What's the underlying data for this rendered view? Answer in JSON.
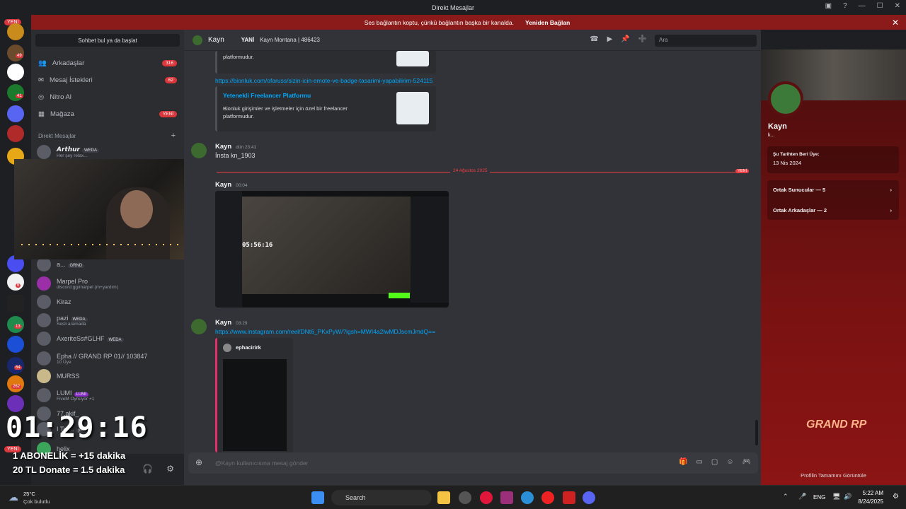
{
  "titlebar": {
    "title": "Direkt Mesajlar"
  },
  "banner": {
    "message": "Ses bağlantın koptu, çünkü bağlantın başka bir kanalda.",
    "action": "Yeniden Bağlan"
  },
  "guilds": {
    "new_badge": "YENİ",
    "new_badge_bottom": "YENİ",
    "counts": [
      "49",
      "41",
      "13",
      "64",
      "262",
      "6"
    ]
  },
  "dmlist": {
    "search": "Sohbet bul ya da başlat",
    "nav": [
      {
        "label": "Arkadaşlar",
        "count": "316"
      },
      {
        "label": "Mesaj İstekleri",
        "count": "62"
      },
      {
        "label": "Nitro Al",
        "count": ""
      },
      {
        "label": "Mağaza",
        "count": "YENİ"
      }
    ],
    "header": "Direkt Mesajlar",
    "users": [
      {
        "name": "𝘼𝙧𝙩𝙝𝙪𝙧",
        "tag": "WEDA",
        "sub": "Her şey relax..."
      },
      {
        "name": "a...",
        "tag": "GRND",
        "sub": ""
      },
      {
        "name": "Marpel Pro",
        "tag": "",
        "sub": "discord.gg/marpel (m+yardım)"
      },
      {
        "name": "Kiraz",
        "tag": "",
        "sub": ""
      },
      {
        "name": "pazi",
        "tag": "WEDA",
        "sub": "Sesli aramada"
      },
      {
        "name": "AxeriteSs#GLHF",
        "tag": "WEDA",
        "sub": ""
      },
      {
        "name": "Epha // GRAND RP 01// 103847",
        "tag": "",
        "sub": "10 Üye"
      },
      {
        "name": "MURSS",
        "tag": "",
        "sub": ""
      },
      {
        "name": "LUMI",
        "tag": "LUMI",
        "sub": "FiveM Oynuyor +1"
      },
      {
        "name": "77.akif_",
        "tag": "",
        "sub": ""
      },
      {
        "name": "I Ter...",
        "tag": "yukt",
        "sub": ""
      },
      {
        "name": "helix",
        "tag": "",
        "sub": ""
      }
    ]
  },
  "overlay": {
    "timer": "01:29:16",
    "line1": "1 ABONELİK = +15 dakika",
    "line2": "20 TL Donate = 1.5 dakika"
  },
  "chat": {
    "header_user": "Kayn",
    "header_new": "YANİ",
    "header_sub": "Kayn Montana | 486423",
    "search_placeholder": "Ara",
    "embed_top_text": "platformudur.",
    "link1": "https://bionluk.com/ofaruss/sizin-icin-emote-ve-badge-tasarimi-yapabilirim-524115",
    "embed_title": "Yetenekli Freelancer Platformu",
    "embed_desc": "Bionluk girişimler ve işletmeler için özel bir freelancer platformudur.",
    "msg1": {
      "author": "Kayn",
      "time": "dün 23:41",
      "text": "İnsta kn_1903"
    },
    "divider_date": "24 Ağustos 2025",
    "divider_new": "YENİ",
    "msg2": {
      "author": "Kayn",
      "time": "00:04"
    },
    "screenshot_timer": "05:56:16",
    "msg3": {
      "author": "Kayn",
      "time": "03:29",
      "link": "https://www.instagram.com/reel/DNt6_PKxPyW/?igsh=MWI4a2lwMDJscmJmdQ=="
    },
    "insta_user": "ephacirirk",
    "composer_placeholder": "@Kayn kullanıcısına mesaj gönder"
  },
  "profile": {
    "name": "Kayn",
    "tagline": "k...",
    "member_since_label": "Şu Tarihten Beri Üye:",
    "member_since": "13 Nis 2024",
    "mutual_servers": "Ortak Sunucular — 5",
    "mutual_friends": "Ortak Arkadaşlar — 2",
    "brand": "GRAND RP",
    "view_full": "Profilin Tamamını Görüntüle"
  },
  "taskbar": {
    "weather_temp": "25°C",
    "weather_desc": "Çok bulutlu",
    "search": "Search",
    "lang": "ENG",
    "time": "5:22 AM",
    "date": "8/24/2025"
  }
}
